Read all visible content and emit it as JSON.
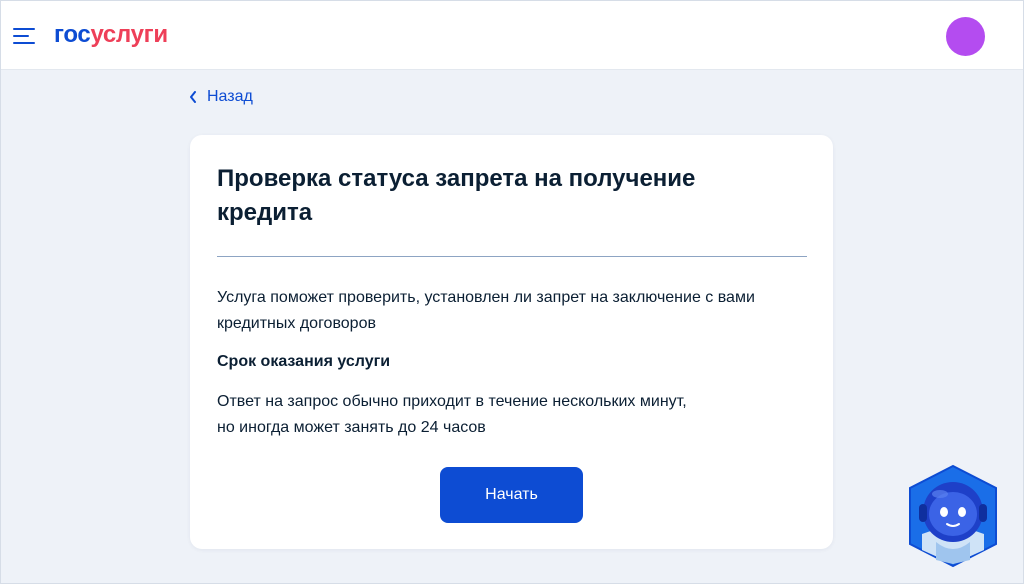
{
  "header": {
    "logo_part1": "гос",
    "logo_part2": "услуги"
  },
  "nav": {
    "back_label": "Назад"
  },
  "card": {
    "title": "Проверка статуса запрета на получение кредита",
    "description": "Услуга поможет проверить, установлен ли запрет на заключение с вами кредитных договоров",
    "term_title": "Срок оказания услуги",
    "term_line1": "Ответ на запрос обычно приходит в течение нескольких минут,",
    "term_line2": "но иногда может занять до 24 часов",
    "start_label": "Начать"
  },
  "icons": {
    "menu": "hamburger-menu-icon",
    "back": "chevron-left-icon",
    "assistant": "robot-assistant-icon"
  },
  "colors": {
    "brand_blue": "#0d4cd3",
    "brand_red": "#ee3f58",
    "avatar": "#b44cf0",
    "background": "#eef2f8",
    "text": "#0b1f33"
  }
}
